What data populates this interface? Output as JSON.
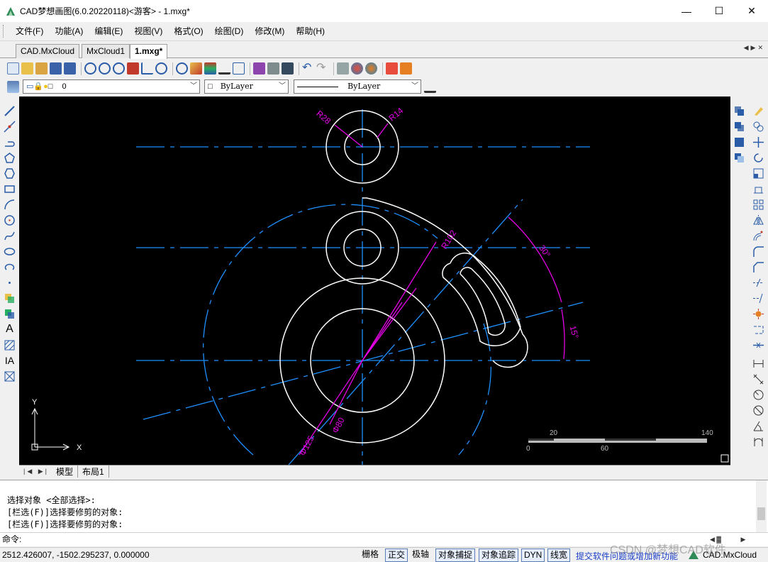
{
  "window": {
    "title": "CAD梦想画图(6.0.20220118)<游客> - 1.mxg*",
    "minimize": "—",
    "maximize": "☐",
    "close": "✕"
  },
  "menu": [
    "文件(F)",
    "功能(A)",
    "编辑(E)",
    "视图(V)",
    "格式(O)",
    "绘图(D)",
    "修改(M)",
    "帮助(H)"
  ],
  "doc_tabs": [
    "CAD.MxCloud",
    "MxCloud1",
    "1.mxg*"
  ],
  "active_doc_tab": "1.mxg*",
  "layer_bar": {
    "layer_name": "0",
    "color": "ByLayer",
    "linetype": "ByLayer"
  },
  "drawing": {
    "labels": {
      "r28": "R28",
      "r14": "R14",
      "r102": "R102",
      "angle30": "30°",
      "angle15": "15°",
      "d80": "Φ80",
      "d125": "Φ125"
    },
    "ucs": {
      "y": "Y",
      "x": "X"
    },
    "scale_bar": {
      "t20": "20",
      "t140": "140",
      "t0": "0",
      "t60": "60"
    },
    "colors": {
      "center": "#1e90ff",
      "geometry": "#ffffff",
      "dimension": "#e600e6"
    }
  },
  "layout_tabs": [
    "模型",
    "布局1"
  ],
  "command": {
    "history": [
      "选择对象 <全部选择>:",
      "[栏选(F)]选择要修剪的对象:",
      "[栏选(F)]选择要修剪的对象:"
    ],
    "prompt": "命令:"
  },
  "status": {
    "coords": "2512.426007,  -1502.295237,  0.000000",
    "toggles": [
      {
        "label": "栅格",
        "on": false
      },
      {
        "label": "正交",
        "on": true
      },
      {
        "label": "极轴",
        "on": false
      },
      {
        "label": "对象捕捉",
        "on": true
      },
      {
        "label": "对象追踪",
        "on": true
      },
      {
        "label": "DYN",
        "on": true
      },
      {
        "label": "线宽",
        "on": true
      }
    ],
    "feedback_link": "提交软件问题或增加新功能",
    "brand": "CAD.MxCloud"
  },
  "watermark": "CSDN @梦想CAD软件"
}
